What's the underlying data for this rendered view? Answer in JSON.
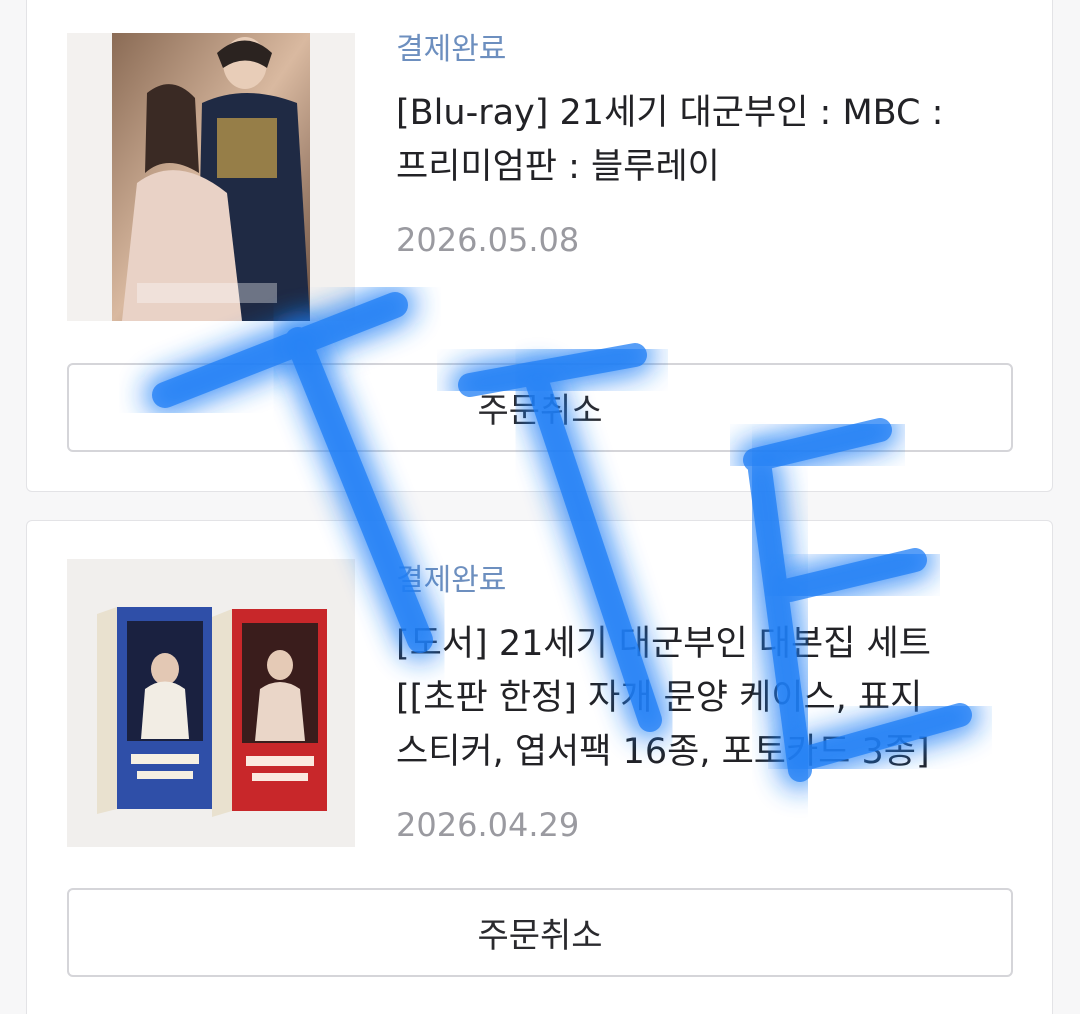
{
  "orders": [
    {
      "status": "결제완료",
      "title": "[Blu-ray] 21세기 대군부인 : MBC : 프리미엄판 : 블루레이",
      "date": "2026.05.08",
      "cancel_label": "주문취소"
    },
    {
      "status": "결제완료",
      "title": "[도서] 21세기 대군부인 대본집 세트 [[초판 한정] 자개 문양 케이스, 표지 스티커, 엽서팩 16종, 포토카드 3종]",
      "date": "2026.04.29",
      "cancel_label": "주문취소"
    }
  ],
  "watermark": {
    "text": "TTE",
    "color": "#1f7ef5"
  }
}
